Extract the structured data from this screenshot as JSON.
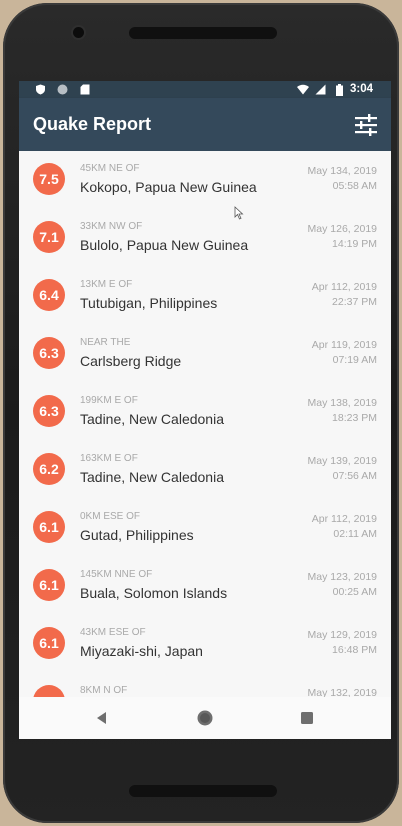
{
  "statusbar": {
    "time": "3:04",
    "left_icons": [
      "shield-icon",
      "circle-icon",
      "sdcard-icon"
    ],
    "right_icons": [
      "wifi-icon",
      "signal-icon",
      "battery-icon"
    ]
  },
  "appbar": {
    "title": "Quake Report",
    "settings_icon": "tune-icon"
  },
  "colors": {
    "appbar": "#34495b",
    "statusbar": "#2f4250",
    "magnitude_circle": "#f26a4b",
    "secondary_text": "#a9a9a9",
    "primary_text": "#333333"
  },
  "quakes": [
    {
      "mag": "7.5",
      "offset": "45km NE of",
      "place": "Kokopo, Papua New Guinea",
      "date": "May 134, 2019",
      "time": "05:58 AM"
    },
    {
      "mag": "7.1",
      "offset": "33km NW of",
      "place": "Bulolo, Papua New Guinea",
      "date": "May 126, 2019",
      "time": "14:19 PM"
    },
    {
      "mag": "6.4",
      "offset": "13km E of",
      "place": "Tutubigan, Philippines",
      "date": "Apr 112, 2019",
      "time": "22:37 PM"
    },
    {
      "mag": "6.3",
      "offset": "Near the",
      "place": "Carlsberg Ridge",
      "date": "Apr 119, 2019",
      "time": "07:19 AM"
    },
    {
      "mag": "6.3",
      "offset": "199km E of",
      "place": "Tadine, New Caledonia",
      "date": "May 138, 2019",
      "time": "18:23 PM"
    },
    {
      "mag": "6.2",
      "offset": "163km E of",
      "place": "Tadine, New Caledonia",
      "date": "May 139, 2019",
      "time": "07:56 AM"
    },
    {
      "mag": "6.1",
      "offset": "0km ESE of",
      "place": "Gutad, Philippines",
      "date": "Apr 112, 2019",
      "time": "02:11 AM"
    },
    {
      "mag": "6.1",
      "offset": "145km NNE of",
      "place": "Buala, Solomon Islands",
      "date": "May 123, 2019",
      "time": "00:25 AM"
    },
    {
      "mag": "6.1",
      "offset": "43km ESE of",
      "place": "Miyazaki-shi, Japan",
      "date": "May 129, 2019",
      "time": "16:48 PM"
    },
    {
      "mag": "",
      "offset": "8km N of",
      "place": "",
      "date": "May 132, 2019",
      "time": ""
    }
  ],
  "navbar": {
    "icons": [
      "back-icon",
      "home-icon",
      "recents-icon"
    ]
  }
}
